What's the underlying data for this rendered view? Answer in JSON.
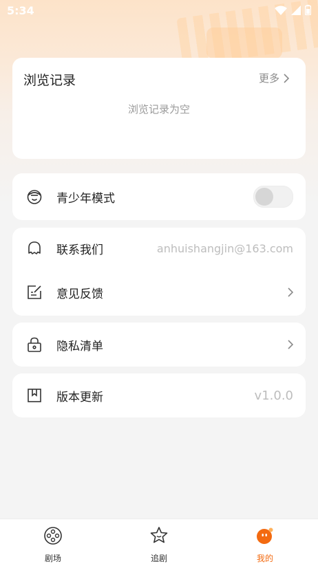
{
  "status_bar": {
    "time": "5:34"
  },
  "history": {
    "title": "浏览记录",
    "more_label": "更多",
    "empty_text": "浏览记录为空"
  },
  "menu": {
    "teen_mode": {
      "label": "青少年模式",
      "toggle_on": false,
      "icon": "teen-face-icon"
    },
    "contact": {
      "label": "联系我们",
      "value": "anhuishangjin@163.com",
      "icon": "chat-bubble-icon"
    },
    "feedback": {
      "label": "意见反馈",
      "icon": "edit-note-icon"
    },
    "privacy": {
      "label": "隐私清单",
      "icon": "lock-icon"
    },
    "version": {
      "label": "版本更新",
      "value": "v1.0.0",
      "icon": "bookmark-icon"
    }
  },
  "tabs": [
    {
      "label": "剧场",
      "icon": "film-reel-icon",
      "active": false
    },
    {
      "label": "追剧",
      "icon": "star-face-icon",
      "active": false
    },
    {
      "label": "我的",
      "icon": "profile-face-icon",
      "active": true
    }
  ],
  "colors": {
    "accent": "#f36a10",
    "background": "#f4f4f4"
  }
}
